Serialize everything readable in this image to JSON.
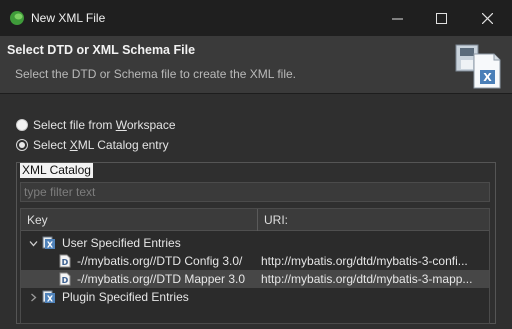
{
  "window": {
    "title": "New XML File"
  },
  "header": {
    "title": "Select DTD or XML Schema File",
    "description": "Select the DTD or Schema file to create the XML file."
  },
  "options": {
    "workspace": {
      "label_pre": "Select file from ",
      "label_underline": "W",
      "label_post": "orkspace",
      "checked": false
    },
    "catalog": {
      "label_pre": "Select ",
      "label_underline": "X",
      "label_post": "ML Catalog entry",
      "checked": true
    }
  },
  "catalog": {
    "group_label": "XML Catalog",
    "filter_placeholder": "type filter text",
    "columns": {
      "key": "Key",
      "uri": "URI:"
    },
    "groups": [
      {
        "label": "User Specified Entries",
        "expanded": true,
        "entries": [
          {
            "key": "-//mybatis.org//DTD Config 3.0/",
            "uri": "http://mybatis.org/dtd/mybatis-3-confi...",
            "selected": false
          },
          {
            "key": "-//mybatis.org//DTD Mapper 3.0",
            "uri": "http://mybatis.org/dtd/mybatis-3-mapp...",
            "selected": true
          }
        ]
      },
      {
        "label": "Plugin Specified Entries",
        "expanded": false,
        "entries": []
      }
    ]
  },
  "colors": {
    "app_icon": "#3f9b3a",
    "header_bg": "#3a3a3a",
    "selection": "#474747"
  }
}
